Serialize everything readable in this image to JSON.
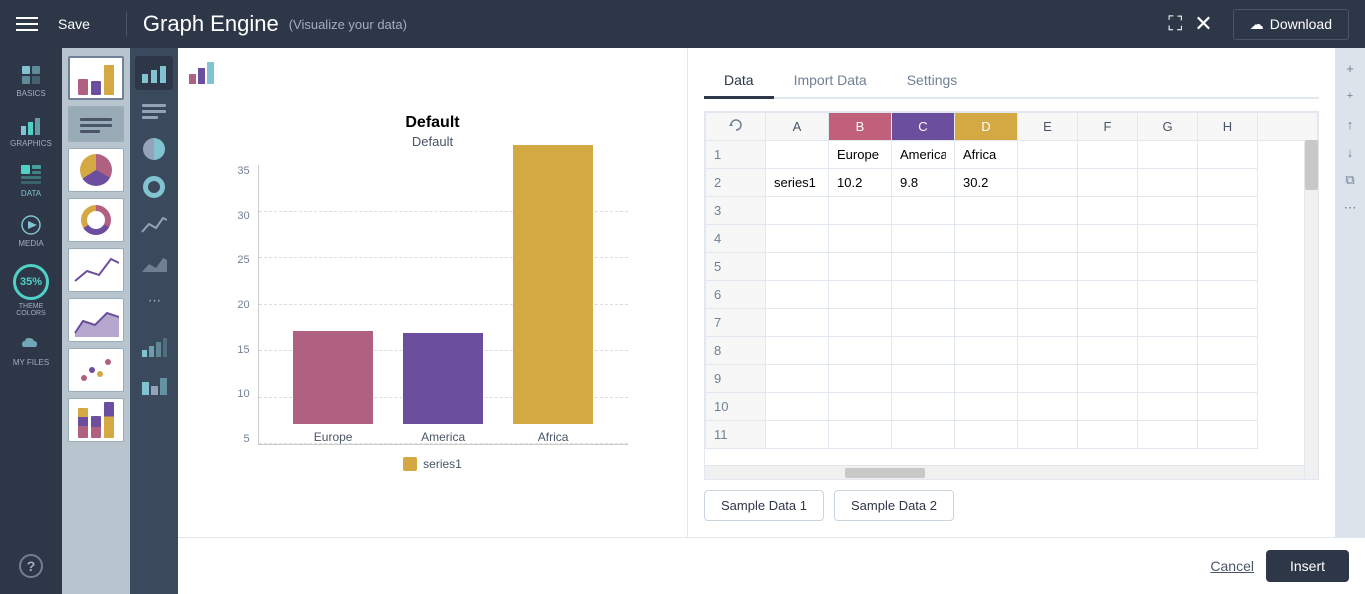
{
  "header": {
    "hamburger_label": "Menu",
    "save_label": "Save",
    "title": "Graph Engine",
    "subtitle": "(Visualize your data)",
    "fullscreen_icon": "⛶",
    "close_icon": "✕",
    "download_label": "Download"
  },
  "sidebar": {
    "items": [
      {
        "id": "basics",
        "label": "BASICS",
        "icon": "□"
      },
      {
        "id": "graphics",
        "label": "GRAPHICS",
        "icon": "⊞"
      },
      {
        "id": "data",
        "label": "DATA",
        "icon": "▦"
      },
      {
        "id": "media",
        "label": "MEDIA",
        "icon": "▶"
      },
      {
        "id": "theme-colors",
        "label": "THEME COLORS",
        "icon": "◉"
      },
      {
        "id": "my-files",
        "label": "MY FILES",
        "icon": "☁"
      }
    ]
  },
  "dialog": {
    "tabs": [
      "Data",
      "Import Data",
      "Settings"
    ],
    "active_tab": "Data",
    "chart": {
      "title": "Default",
      "subtitle": "Default",
      "bars": [
        {
          "label": "Europe",
          "value": 10.2,
          "color": "#b06080",
          "height_pct": 33
        },
        {
          "label": "America",
          "value": 9.8,
          "color": "#6b4f9e",
          "height_pct": 32
        },
        {
          "label": "Africa",
          "value": 30.2,
          "color": "#d4a843",
          "height_pct": 99
        }
      ],
      "y_axis": [
        5,
        10,
        15,
        20,
        25,
        30,
        35
      ],
      "legend": [
        {
          "label": "series1",
          "color": "#d4a843"
        }
      ]
    },
    "grid": {
      "col_headers": [
        "",
        "A",
        "B",
        "C",
        "D",
        "E",
        "F",
        "G",
        "H"
      ],
      "col_colors": {
        "B": "#c0607a",
        "C": "#6b4f9e",
        "D": "#d4a843"
      },
      "rows": [
        {
          "num": "1",
          "cells": [
            "",
            "Europe",
            "America",
            "Africa",
            "",
            "",
            "",
            ""
          ]
        },
        {
          "num": "2",
          "cells": [
            "series1",
            "10.2",
            "9.8",
            "30.2",
            "",
            "",
            "",
            ""
          ]
        },
        {
          "num": "3",
          "cells": [
            "",
            "",
            "",
            "",
            "",
            "",
            "",
            ""
          ]
        },
        {
          "num": "4",
          "cells": [
            "",
            "",
            "",
            "",
            "",
            "",
            "",
            ""
          ]
        },
        {
          "num": "5",
          "cells": [
            "",
            "",
            "",
            "",
            "",
            "",
            "",
            ""
          ]
        },
        {
          "num": "6",
          "cells": [
            "",
            "",
            "",
            "",
            "",
            "",
            "",
            ""
          ]
        },
        {
          "num": "7",
          "cells": [
            "",
            "",
            "",
            "",
            "",
            "",
            "",
            ""
          ]
        },
        {
          "num": "8",
          "cells": [
            "",
            "",
            "",
            "",
            "",
            "",
            "",
            ""
          ]
        },
        {
          "num": "9",
          "cells": [
            "",
            "",
            "",
            "",
            "",
            "",
            "",
            ""
          ]
        },
        {
          "num": "10",
          "cells": [
            "",
            "",
            "",
            "",
            "",
            "",
            "",
            ""
          ]
        },
        {
          "num": "11",
          "cells": [
            "",
            "",
            "",
            "",
            "",
            "",
            "",
            ""
          ]
        }
      ]
    },
    "sample_buttons": [
      "Sample Data 1",
      "Sample Data 2"
    ],
    "cancel_label": "Cancel",
    "insert_label": "Insert"
  },
  "left_icons": [
    "≡",
    "●",
    "◎",
    "〰",
    "▲",
    "•••",
    "▦"
  ],
  "preview_thumbs": [
    "bar1",
    "bar2",
    "pie",
    "bar3",
    "dots",
    "bar4"
  ]
}
